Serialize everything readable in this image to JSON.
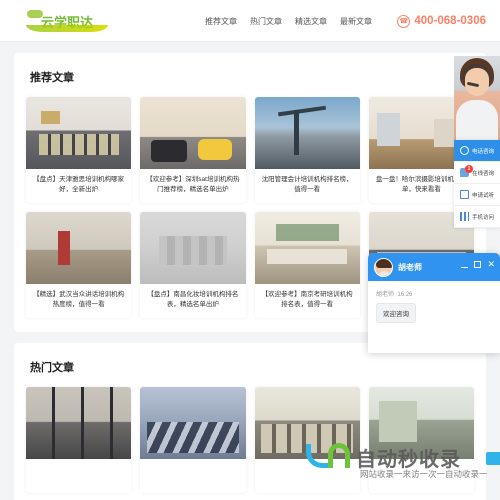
{
  "header": {
    "logo_text": "云学职达",
    "nav": [
      {
        "label": "推荐文章"
      },
      {
        "label": "热门文章"
      },
      {
        "label": "精选文章"
      },
      {
        "label": "最新文章"
      }
    ],
    "phone": "400-068-0306",
    "phone_icon": "phone-circle-icon",
    "phone_color": "#ff7f66"
  },
  "sections": [
    {
      "title": "推荐文章",
      "cards": [
        {
          "caption": "【盘点】天津雅思培训机构哪家好，全新出炉",
          "photo": "classroom"
        },
        {
          "caption": "【欢迎参考】深圳sat培训机构热门推荐榜，精选名单出炉",
          "photo": "lounge"
        },
        {
          "caption": "沈阳管理会计培训机构排名榜，值得一看",
          "photo": "port"
        },
        {
          "caption": "盘一盘！哈尔滨摄影培训机构榜单，快来看看",
          "photo": "studio"
        },
        {
          "caption": "【精选】武汉当众讲话培训机构热度榜，值得一看",
          "photo": "hall"
        },
        {
          "caption": "【盘点】南昌化妆培训机构排名表，精选名单出炉",
          "photo": "gray"
        },
        {
          "caption": "【欢迎参考】南京考研培训机构排名表，值得一看",
          "photo": "counter"
        },
        {
          "caption": "",
          "photo": "meeting"
        }
      ]
    },
    {
      "title": "热门文章",
      "cards": [
        {
          "caption": "",
          "photo": "glass"
        },
        {
          "caption": "",
          "photo": "students"
        },
        {
          "caption": "",
          "photo": "lecture"
        },
        {
          "caption": "",
          "photo": "office"
        }
      ]
    }
  ],
  "service_panel": {
    "items": [
      {
        "label": "电话咨询",
        "icon": "phone-icon",
        "active": true,
        "badge": ""
      },
      {
        "label": "在线咨询",
        "icon": "chat-icon",
        "active": false,
        "badge": "1"
      },
      {
        "label": "申请试听",
        "icon": "book-icon",
        "active": false,
        "badge": ""
      },
      {
        "label": "手机访问",
        "icon": "qrcode-icon",
        "active": false,
        "badge": ""
      }
    ],
    "active_color": "#2f8fe8"
  },
  "chat": {
    "title": "胡老师",
    "sender": "胡老师",
    "time": "16:26",
    "message": "欢迎咨询",
    "header_color": "#2f93ef",
    "controls": {
      "minimize": "−",
      "maximize": "□",
      "close": "✕"
    }
  },
  "watermark": {
    "text": "自动秒收录",
    "subtitle": "网站收录一来访一次一自动收录一",
    "logo_name": "jn-logo-icon"
  }
}
